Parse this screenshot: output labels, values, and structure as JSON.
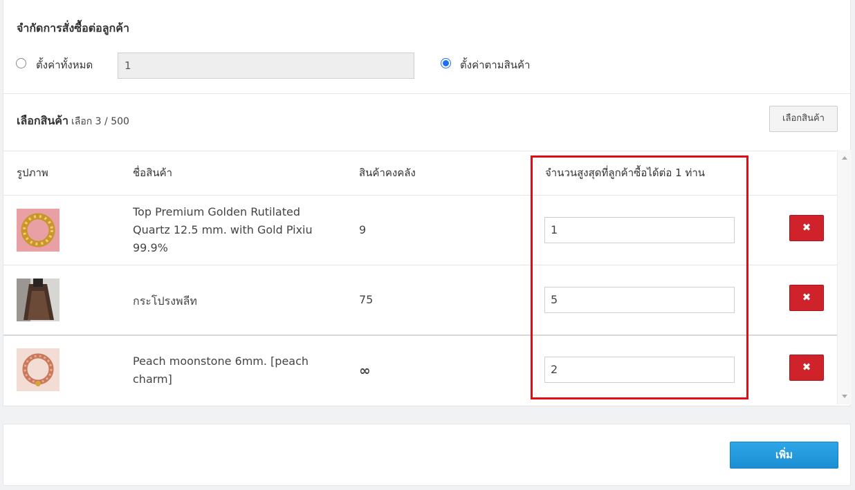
{
  "limit_section": {
    "title": "จำกัดการสั่งซื้อต่อลูกค้า",
    "option_all_label": "ตั้งค่าทั้งหมด",
    "option_all_value": "1",
    "option_per_product_label": "ตั้งค่าตามสินค้า",
    "selected_option": "per_product"
  },
  "product_select": {
    "title": "เลือกสินค้า",
    "count_text": "เลือก 3 / 500",
    "select_button_label": "เลือกสินค้า"
  },
  "table": {
    "headers": [
      "รูปภาพ",
      "ชื่อสินค้า",
      "สินค้าคงคลัง",
      "จำนวนสูงสุดที่ลูกค้าซื้อได้ต่อ 1 ท่าน"
    ],
    "rows": [
      {
        "name": "Top Premium Golden Rutilated Quartz 12.5 mm. with Gold Pixiu 99.9%",
        "stock": "9",
        "max_qty": "1",
        "delete_label": "✖"
      },
      {
        "name": "กระโปรงพลีท",
        "stock": "75",
        "max_qty": "5",
        "delete_label": "✖"
      },
      {
        "name": "Peach moonstone 6mm. [peach charm]",
        "stock": "∞",
        "max_qty": "2",
        "delete_label": "✖"
      }
    ]
  },
  "footer": {
    "add_button_label": "เพิ่ม"
  },
  "colors": {
    "highlight": "#e50914",
    "primary_blue": "#1b8ed2",
    "delete_red": "#d0222a",
    "radio_checked": "#1a73e8"
  }
}
